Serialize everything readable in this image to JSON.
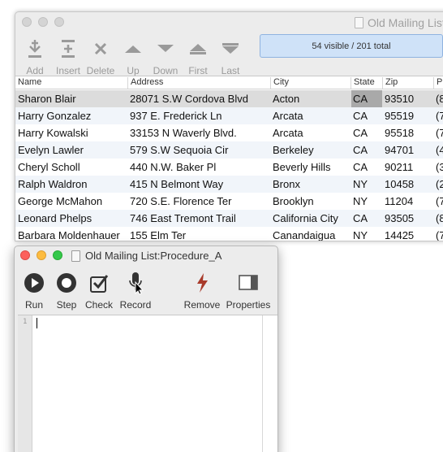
{
  "records_window": {
    "title": "Old Mailing List",
    "toolbar": [
      {
        "label": "Add",
        "icon": "add-record-icon"
      },
      {
        "label": "Insert",
        "icon": "insert-record-icon"
      },
      {
        "label": "Delete",
        "icon": "delete-record-icon"
      },
      {
        "label": "Up",
        "icon": "up-arrow-icon"
      },
      {
        "label": "Down",
        "icon": "down-arrow-icon"
      },
      {
        "label": "First",
        "icon": "first-record-icon"
      },
      {
        "label": "Last",
        "icon": "last-record-icon"
      }
    ],
    "status": "54 visible / 201 total",
    "columns": [
      "Name",
      "Address",
      "City",
      "State",
      "Zip",
      "Ph"
    ],
    "rows": [
      {
        "name": "Sharon Blair",
        "address": "28071 S.W Cordova Blvd",
        "city": "Acton",
        "state": "CA",
        "zip": "93510",
        "phone": "(8"
      },
      {
        "name": "Harry Gonzalez",
        "address": "937 E. Frederick Ln",
        "city": "Arcata",
        "state": "CA",
        "zip": "95519",
        "phone": "(7"
      },
      {
        "name": "Harry Kowalski",
        "address": "33153 N Waverly Blvd.",
        "city": "Arcata",
        "state": "CA",
        "zip": "95518",
        "phone": "(7"
      },
      {
        "name": "Evelyn Lawler",
        "address": "579 S.W Sequoia Cir",
        "city": "Berkeley",
        "state": "CA",
        "zip": "94701",
        "phone": "(4"
      },
      {
        "name": "Cheryl Scholl",
        "address": "440 N.W. Baker Pl",
        "city": "Beverly Hills",
        "state": "CA",
        "zip": "90211",
        "phone": "(3"
      },
      {
        "name": "Ralph Waldron",
        "address": "415 N Belmont Way",
        "city": "Bronx",
        "state": "NY",
        "zip": "10458",
        "phone": "(2"
      },
      {
        "name": "George McMahon",
        "address": "720 S.E. Florence Ter",
        "city": "Brooklyn",
        "state": "NY",
        "zip": "11204",
        "phone": "(7"
      },
      {
        "name": "Leonard Phelps",
        "address": "746 East Tremont Trail",
        "city": "California City",
        "state": "CA",
        "zip": "93505",
        "phone": "(8"
      },
      {
        "name": "Barbara Moldenhauer",
        "address": "155 Elm Ter",
        "city": "Canandaigua",
        "state": "NY",
        "zip": "14425",
        "phone": "(7"
      }
    ]
  },
  "procedure_window": {
    "title": "Old Mailing List:Procedure_A",
    "toolbar": [
      {
        "label": "Run",
        "icon": "run-icon"
      },
      {
        "label": "Step",
        "icon": "step-icon"
      },
      {
        "label": "Check",
        "icon": "check-icon"
      },
      {
        "label": "Record",
        "icon": "record-microphone-icon"
      },
      {
        "label": "Remove",
        "icon": "remove-lightning-icon"
      },
      {
        "label": "Properties",
        "icon": "properties-icon"
      }
    ],
    "line_number": "1"
  },
  "colors": {
    "status_bg": "#cfe2f8",
    "remove_icon": "#a83a2a",
    "selected_row": "#dcdcdc"
  }
}
